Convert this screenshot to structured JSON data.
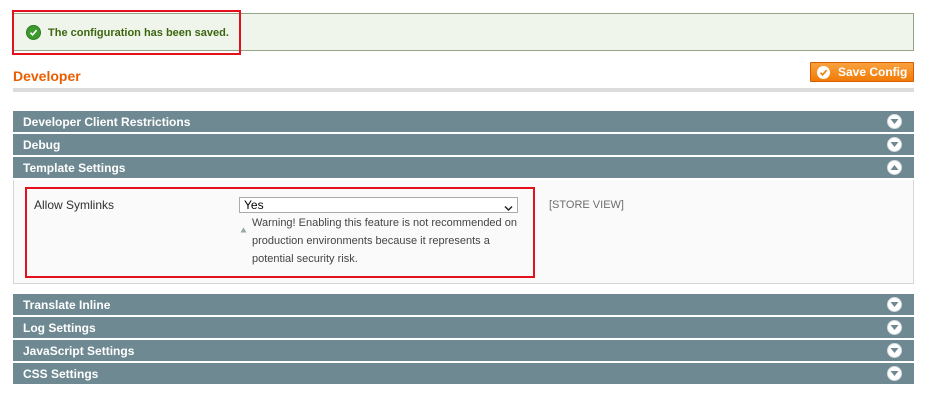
{
  "messages": {
    "success": "The configuration has been saved."
  },
  "page": {
    "title": "Developer",
    "save_button": "Save Config"
  },
  "sections": [
    {
      "label": "Developer Client Restrictions",
      "state": "collapsed"
    },
    {
      "label": "Debug",
      "state": "collapsed"
    },
    {
      "label": "Template Settings",
      "state": "expanded"
    },
    {
      "label": "Translate Inline",
      "state": "collapsed"
    },
    {
      "label": "Log Settings",
      "state": "collapsed"
    },
    {
      "label": "JavaScript Settings",
      "state": "collapsed"
    },
    {
      "label": "CSS Settings",
      "state": "collapsed"
    }
  ],
  "template_settings": {
    "field_label": "Allow Symlinks",
    "selected_value": "Yes",
    "note_lines": [
      "Warning! Enabling this feature is not recommended on",
      "production environments because it represents a",
      "potential security risk."
    ],
    "scope": "[STORE VIEW]"
  },
  "colors": {
    "section_header_bg": "#6f8992",
    "title_orange": "#eb5e00",
    "button_orange": "#f27b06",
    "success_bg": "#eff5ea",
    "success_text": "#3d6611",
    "highlight_red": "#e3101d"
  }
}
